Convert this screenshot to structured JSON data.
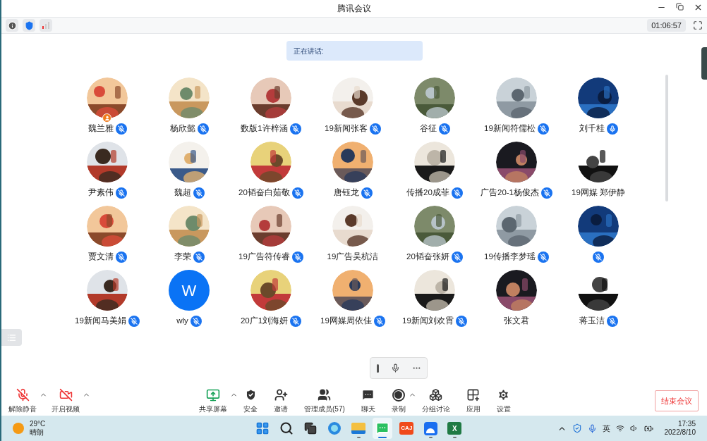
{
  "window": {
    "title": "腾讯会议"
  },
  "toolbar_top": {
    "timer": "01:06:57"
  },
  "speaking": {
    "label": "正在讲话:"
  },
  "participants": [
    {
      "name": "魏兰雅",
      "kind": "picture",
      "mic": {
        "muted": true
      },
      "host": true
    },
    {
      "name": "杨欣懿",
      "kind": "picture",
      "mic": {
        "muted": true
      },
      "host": false
    },
    {
      "name": "数版1许梓涵",
      "kind": "picture",
      "mic": {
        "muted": true
      },
      "host": false
    },
    {
      "name": "19新闻张客",
      "kind": "picture",
      "mic": {
        "muted": true
      },
      "host": false
    },
    {
      "name": "谷征",
      "kind": "picture",
      "mic": {
        "muted": true
      },
      "host": false
    },
    {
      "name": "19新闻符儒松",
      "kind": "picture",
      "mic": {
        "muted": true
      },
      "host": false
    },
    {
      "name": "刘千桂",
      "kind": "picture",
      "mic": {
        "muted": false
      },
      "host": false
    },
    {
      "name": "尹素伟",
      "kind": "picture",
      "mic": {
        "muted": true
      },
      "host": false
    },
    {
      "name": "魏超",
      "kind": "picture",
      "mic": {
        "muted": true
      },
      "host": false
    },
    {
      "name": "20韬奋白茹敬",
      "kind": "picture",
      "mic": {
        "muted": true
      },
      "host": false
    },
    {
      "name": "唐钰龙",
      "kind": "picture",
      "mic": {
        "muted": true
      },
      "host": false
    },
    {
      "name": "传播20成菲",
      "kind": "picture",
      "mic": {
        "muted": true
      },
      "host": false
    },
    {
      "name": "广告20-1杨俊杰",
      "kind": "picture",
      "mic": {
        "muted": true
      },
      "host": false
    },
    {
      "name": "19网媒 郑伊静",
      "kind": "picture",
      "host": false
    },
    {
      "name": "贾文清",
      "kind": "picture",
      "mic": {
        "muted": true
      },
      "host": false
    },
    {
      "name": "李荣",
      "kind": "picture",
      "mic": {
        "muted": true
      },
      "host": false
    },
    {
      "name": "19广告符传睿",
      "kind": "picture",
      "mic": {
        "muted": true
      },
      "host": false
    },
    {
      "name": "19广告吴杭洁",
      "kind": "picture",
      "host": false
    },
    {
      "name": "20韬奋张妍",
      "kind": "picture",
      "mic": {
        "muted": true
      },
      "host": false
    },
    {
      "name": "19传播李梦瑶",
      "kind": "picture",
      "mic": {
        "muted": true
      },
      "host": false
    },
    {
      "kind": "picture",
      "mic": {
        "muted": true
      },
      "host": false
    },
    {
      "name": "19新闻马美娟",
      "kind": "picture",
      "mic": {
        "muted": true
      },
      "host": false
    },
    {
      "name": "wly",
      "kind": "letter",
      "letter": "W",
      "mic": {
        "muted": true
      },
      "host": false
    },
    {
      "name": "20广1刘海妍",
      "kind": "picture",
      "mic": {
        "muted": true
      },
      "host": false
    },
    {
      "name": "19网媒周依佳",
      "kind": "picture",
      "mic": {
        "muted": true
      },
      "host": false
    },
    {
      "name": "19新闻刘欢霄",
      "kind": "picture",
      "mic": {
        "muted": true
      },
      "host": false
    },
    {
      "name": "张文君",
      "kind": "picture",
      "host": false
    },
    {
      "name": "蒋玉洁",
      "kind": "picture",
      "mic": {
        "muted": true
      },
      "host": false
    }
  ],
  "left_tools": [
    {
      "label": "解除静音",
      "menu": true
    },
    {
      "label": "开启视频",
      "menu": true
    }
  ],
  "center_tools": [
    {
      "label": "共享屏幕",
      "menu": true
    },
    {
      "label": "安全",
      "menu": false
    },
    {
      "label": "邀请",
      "menu": false
    },
    {
      "label": "管理成员(57)",
      "menu": false
    },
    {
      "label": "聊天",
      "menu": false
    },
    {
      "label": "录制",
      "menu": true
    },
    {
      "label": "分组讨论",
      "menu": false
    },
    {
      "label": "应用",
      "menu": false
    },
    {
      "label": "设置",
      "menu": false
    }
  ],
  "end_button": "结束会议",
  "taskbar": {
    "weather": {
      "temp": "29°C",
      "desc": "晴朗"
    },
    "apps": [
      {
        "running": false,
        "selected": false
      },
      {
        "running": false,
        "selected": false
      },
      {
        "running": false,
        "selected": false
      },
      {
        "running": false,
        "selected": false
      },
      {
        "running": true,
        "selected": false
      },
      {
        "running": true,
        "selected": true
      },
      {
        "running": false,
        "selected": false
      },
      {
        "running": true,
        "selected": false
      },
      {
        "running": true,
        "selected": false
      }
    ],
    "caj_label": "CAJ",
    "excel_label": "X",
    "ime": "英",
    "time": "17:35",
    "date": "2022/8/10"
  }
}
